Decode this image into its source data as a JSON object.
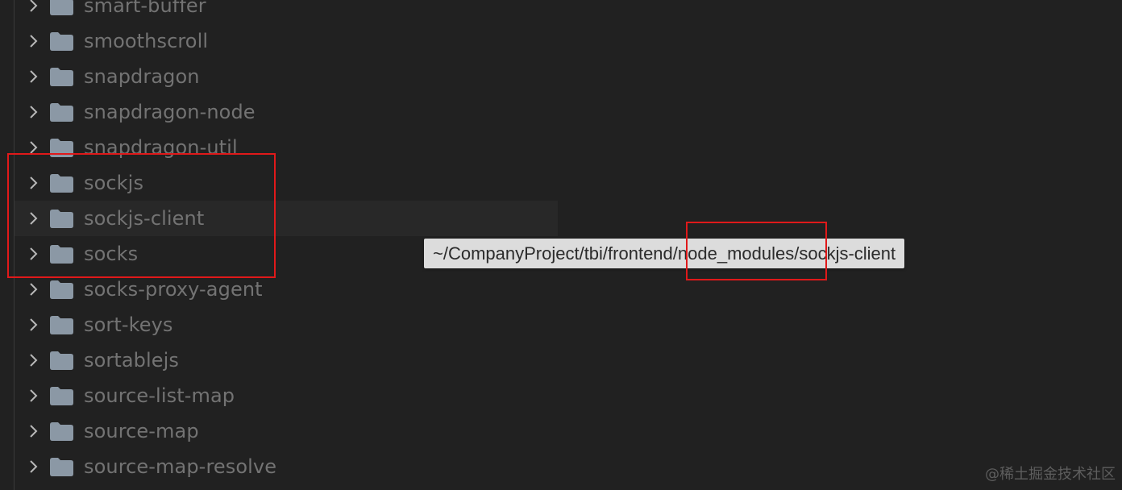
{
  "explorer": {
    "items": [
      {
        "label": "smart-buffer"
      },
      {
        "label": "smoothscroll"
      },
      {
        "label": "snapdragon"
      },
      {
        "label": "snapdragon-node"
      },
      {
        "label": "snapdragon-util"
      },
      {
        "label": "sockjs"
      },
      {
        "label": "sockjs-client"
      },
      {
        "label": "socks"
      },
      {
        "label": "socks-proxy-agent"
      },
      {
        "label": "sort-keys"
      },
      {
        "label": "sortablejs"
      },
      {
        "label": "source-list-map"
      },
      {
        "label": "source-map"
      },
      {
        "label": "source-map-resolve"
      }
    ],
    "hovered_item": "sockjs-client",
    "chevron_icon": "chevron-right-icon",
    "folder_icon": "folder-icon"
  },
  "tooltip": {
    "text": "~/CompanyProject/tbi/frontend/node_modules/sockjs-client"
  },
  "watermark": {
    "text": "@稀土掘金技术社区"
  },
  "colors": {
    "background": "#212121",
    "label": "#737373",
    "folder": "#8b98a5",
    "highlight": "#e0191a",
    "tooltip_bg": "#dcdcdc"
  }
}
